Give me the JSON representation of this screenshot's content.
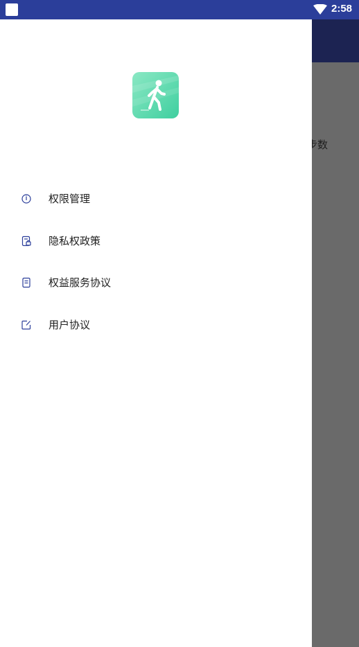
{
  "status_bar": {
    "time": "2:58",
    "wifi_icon": "wifi-icon",
    "notification_icon": "app-notification-icon",
    "color": "#2b3e9a"
  },
  "background_app": {
    "toolbar_color": "#1c2352",
    "partial_label": "步数"
  },
  "drawer": {
    "logo_icon": "walking-person-icon",
    "logo_colors": [
      "#3fcf9f",
      "#8be8c4"
    ],
    "menu": [
      {
        "label": "权限管理",
        "icon": "info-circle-icon"
      },
      {
        "label": "隐私权政策",
        "icon": "privacy-document-icon"
      },
      {
        "label": "权益服务协议",
        "icon": "document-icon"
      },
      {
        "label": "用户协议",
        "icon": "edit-note-icon"
      }
    ]
  }
}
